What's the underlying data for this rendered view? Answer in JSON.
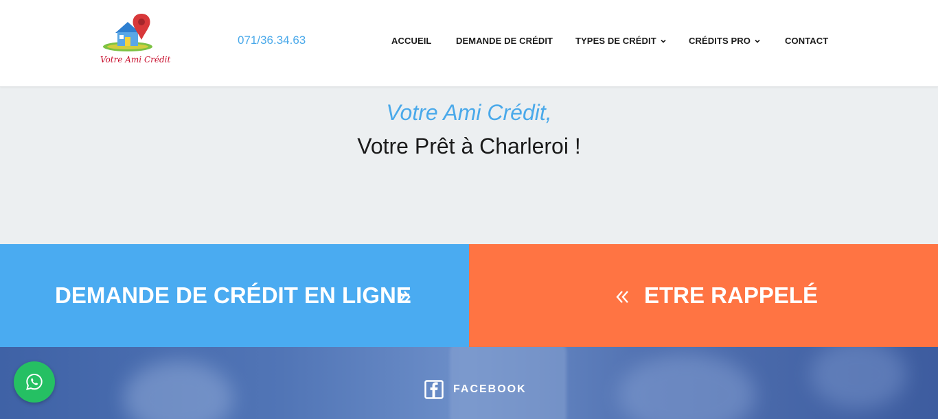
{
  "header": {
    "logo_text": "Votre Ami Crédit",
    "phone": "071/36.34.63",
    "nav": [
      {
        "label": "ACCUEIL",
        "has_dropdown": false
      },
      {
        "label": "DEMANDE DE CRÉDIT",
        "has_dropdown": false
      },
      {
        "label": "TYPES DE CRÉDIT",
        "has_dropdown": true,
        "icon": "chevron-down-icon"
      },
      {
        "label": "CRÉDITS PRO",
        "has_dropdown": true,
        "icon": "chevron-down-icon"
      },
      {
        "label": "CONTACT",
        "has_dropdown": false
      }
    ]
  },
  "hero": {
    "subtitle": "Votre Ami Crédit,",
    "title": "Votre Prêt à Charleroi !"
  },
  "cta": {
    "online": {
      "label": "DEMANDE DE CRÉDIT EN LIGNE",
      "icon": "double-chevron-right-icon",
      "color": "#4aabf1"
    },
    "callback": {
      "label": "ETRE RAPPELÉ",
      "icon": "double-chevron-left-icon",
      "color": "#ff7443"
    }
  },
  "social": {
    "facebook_label": "FACEBOOK",
    "icon": "facebook-icon"
  },
  "whatsapp": {
    "icon": "whatsapp-icon",
    "color": "#25c063"
  },
  "colors": {
    "accent_blue": "#4aa9ea",
    "accent_orange": "#ff7443"
  }
}
